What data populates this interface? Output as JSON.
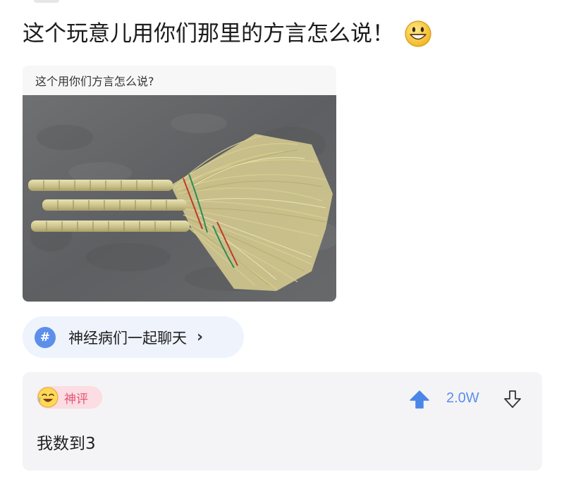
{
  "post": {
    "title": "这个玩意儿用你们那里的方言怎么说！",
    "title_emoji": "grinning-face-icon"
  },
  "media": {
    "caption": "这个用你们方言怎么说?",
    "image_subject": "three straw brooms on concrete"
  },
  "topic": {
    "hash_symbol": "#",
    "label": "神经病们一起聊天",
    "arrow": "›"
  },
  "comment": {
    "badge_label": "神评",
    "badge_icon": "laughing-face-icon",
    "vote_count": "2.0W",
    "text": "我数到3"
  },
  "colors": {
    "accent_blue": "#5b8fea",
    "badge_pink": "#e25575",
    "badge_pink_bg": "#fbdde3",
    "chip_bg": "#eef3fc",
    "comment_bg": "#f4f4f6"
  }
}
